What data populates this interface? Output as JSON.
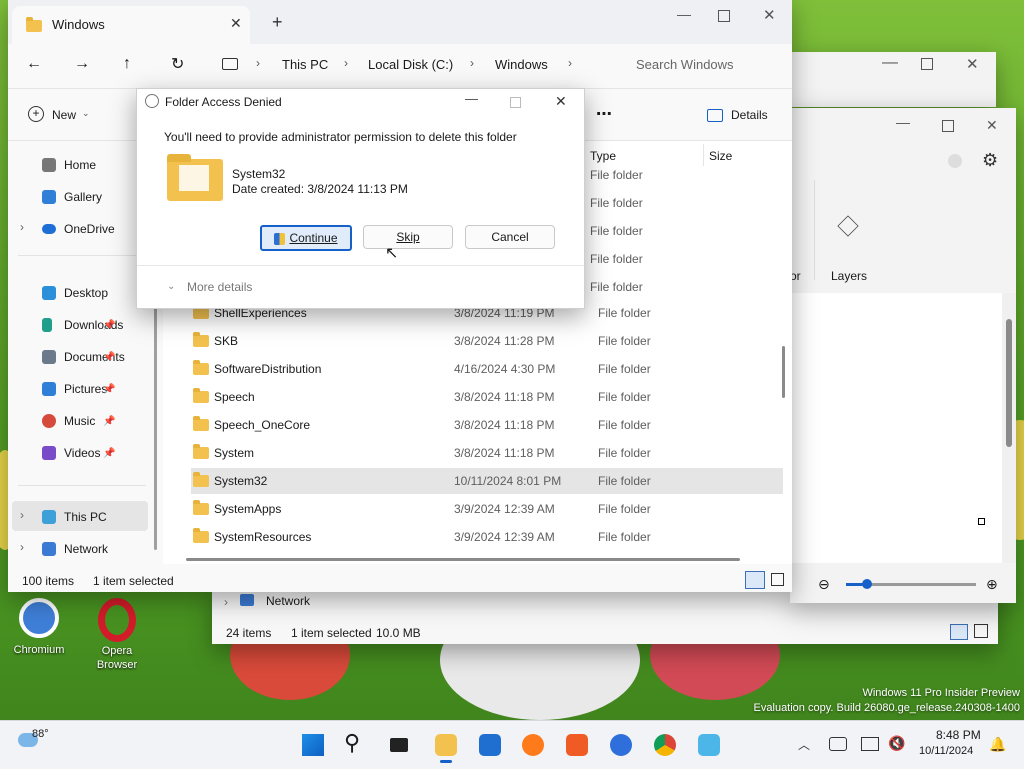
{
  "explorer": {
    "tab_title": "Windows",
    "breadcrumb": [
      "This PC",
      "Local Disk (C:)",
      "Windows"
    ],
    "search_placeholder": "Search Windows",
    "new_label": "New",
    "details_label": "Details",
    "nav_items": [
      {
        "label": "Home",
        "icon": "home-icon"
      },
      {
        "label": "Gallery",
        "icon": "gallery-icon"
      },
      {
        "label": "OneDrive",
        "icon": "cloud-icon"
      },
      {
        "label": "Desktop",
        "icon": "desktop-icon"
      },
      {
        "label": "Downloads",
        "icon": "download-icon"
      },
      {
        "label": "Documents",
        "icon": "documents-icon"
      },
      {
        "label": "Pictures",
        "icon": "pictures-icon"
      },
      {
        "label": "Music",
        "icon": "music-icon"
      },
      {
        "label": "Videos",
        "icon": "videos-icon"
      },
      {
        "label": "This PC",
        "icon": "pc-icon"
      },
      {
        "label": "Network",
        "icon": "network-icon"
      }
    ],
    "columns": {
      "type": "Type",
      "size": "Size"
    },
    "rows_hidden_types": [
      "File folder",
      "File folder",
      "File folder",
      "File folder",
      "File folder"
    ],
    "rows": [
      {
        "name": "ShellExperiences",
        "date": "3/8/2024 11:19 PM",
        "type": "File folder"
      },
      {
        "name": "SKB",
        "date": "3/8/2024 11:28 PM",
        "type": "File folder"
      },
      {
        "name": "SoftwareDistribution",
        "date": "4/16/2024 4:30 PM",
        "type": "File folder"
      },
      {
        "name": "Speech",
        "date": "3/8/2024 11:18 PM",
        "type": "File folder"
      },
      {
        "name": "Speech_OneCore",
        "date": "3/8/2024 11:18 PM",
        "type": "File folder"
      },
      {
        "name": "System",
        "date": "3/8/2024 11:18 PM",
        "type": "File folder"
      },
      {
        "name": "System32",
        "date": "10/11/2024 8:01 PM",
        "type": "File folder"
      },
      {
        "name": "SystemApps",
        "date": "3/9/2024 12:39 AM",
        "type": "File folder"
      },
      {
        "name": "SystemResources",
        "date": "3/9/2024 12:39 AM",
        "type": "File folder"
      }
    ],
    "status_count": "100 items",
    "status_selected": "1 item selected"
  },
  "dialog": {
    "title": "Folder Access Denied",
    "message": "You'll need to provide administrator permission to delete this folder",
    "item_name": "System32",
    "item_date": "Date created: 3/8/2024 11:13 PM",
    "continue_label": "Continue",
    "skip_label": "Skip",
    "cancel_label": "Cancel",
    "more_details": "More details"
  },
  "paint": {
    "layers_label": "Layers",
    "partial_label": "or"
  },
  "bg_explorer": {
    "network_label": "Network",
    "status_count": "24 items",
    "status_selected": "1 item selected",
    "status_size": "10.0 MB"
  },
  "desktop": {
    "icons": [
      {
        "label": "Chromium"
      },
      {
        "label": "Opera Browser"
      }
    ],
    "watermark_line1": "Windows 11 Pro Insider Preview",
    "watermark_line2": "Evaluation copy. Build 26080.ge_release.240308-1400"
  },
  "taskbar": {
    "weather_temp": "88°",
    "time": "8:48 PM",
    "date": "10/11/2024"
  }
}
